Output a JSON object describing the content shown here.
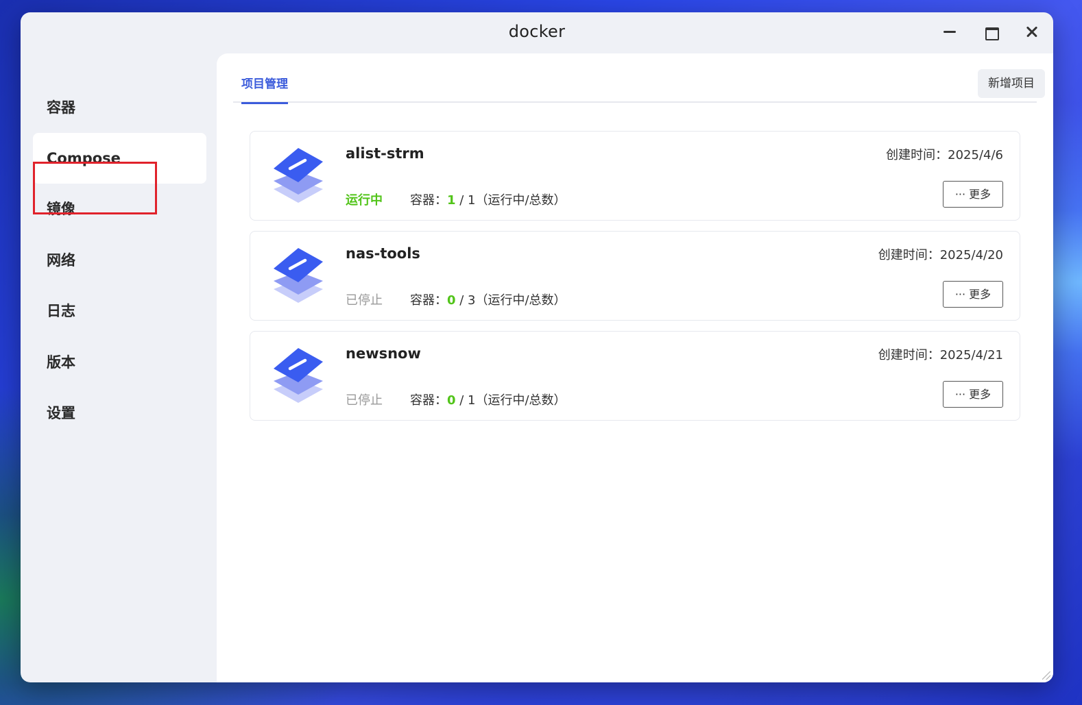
{
  "window": {
    "title": "docker"
  },
  "sidebar": {
    "items": [
      {
        "label": "容器"
      },
      {
        "label": "Compose"
      },
      {
        "label": "镜像"
      },
      {
        "label": "网络"
      },
      {
        "label": "日志"
      },
      {
        "label": "版本"
      },
      {
        "label": "设置"
      }
    ],
    "active_index": 1
  },
  "main": {
    "tab_label": "项目管理",
    "new_project_label": "新增项目",
    "projects": [
      {
        "name": "alist-strm",
        "created": "创建时间：2025/4/6",
        "status": "运行中",
        "status_type": "running",
        "count_label": "容器：",
        "running": "1",
        "total_text": " / 1（运行中/总数）",
        "more_label": "··· 更多"
      },
      {
        "name": "nas-tools",
        "created": "创建时间：2025/4/20",
        "status": "已停止",
        "status_type": "stopped",
        "count_label": "容器：",
        "running": "0",
        "total_text": " / 3（运行中/总数）",
        "more_label": "··· 更多"
      },
      {
        "name": "newsnow",
        "created": "创建时间：2025/4/21",
        "status": "已停止",
        "status_type": "stopped",
        "count_label": "容器：",
        "running": "0",
        "total_text": " / 1（运行中/总数）",
        "more_label": "··· 更多"
      }
    ]
  },
  "colors": {
    "accent": "#3b5bdb",
    "running": "#52c41a",
    "stopped": "#999999",
    "highlight": "#e0222b"
  }
}
